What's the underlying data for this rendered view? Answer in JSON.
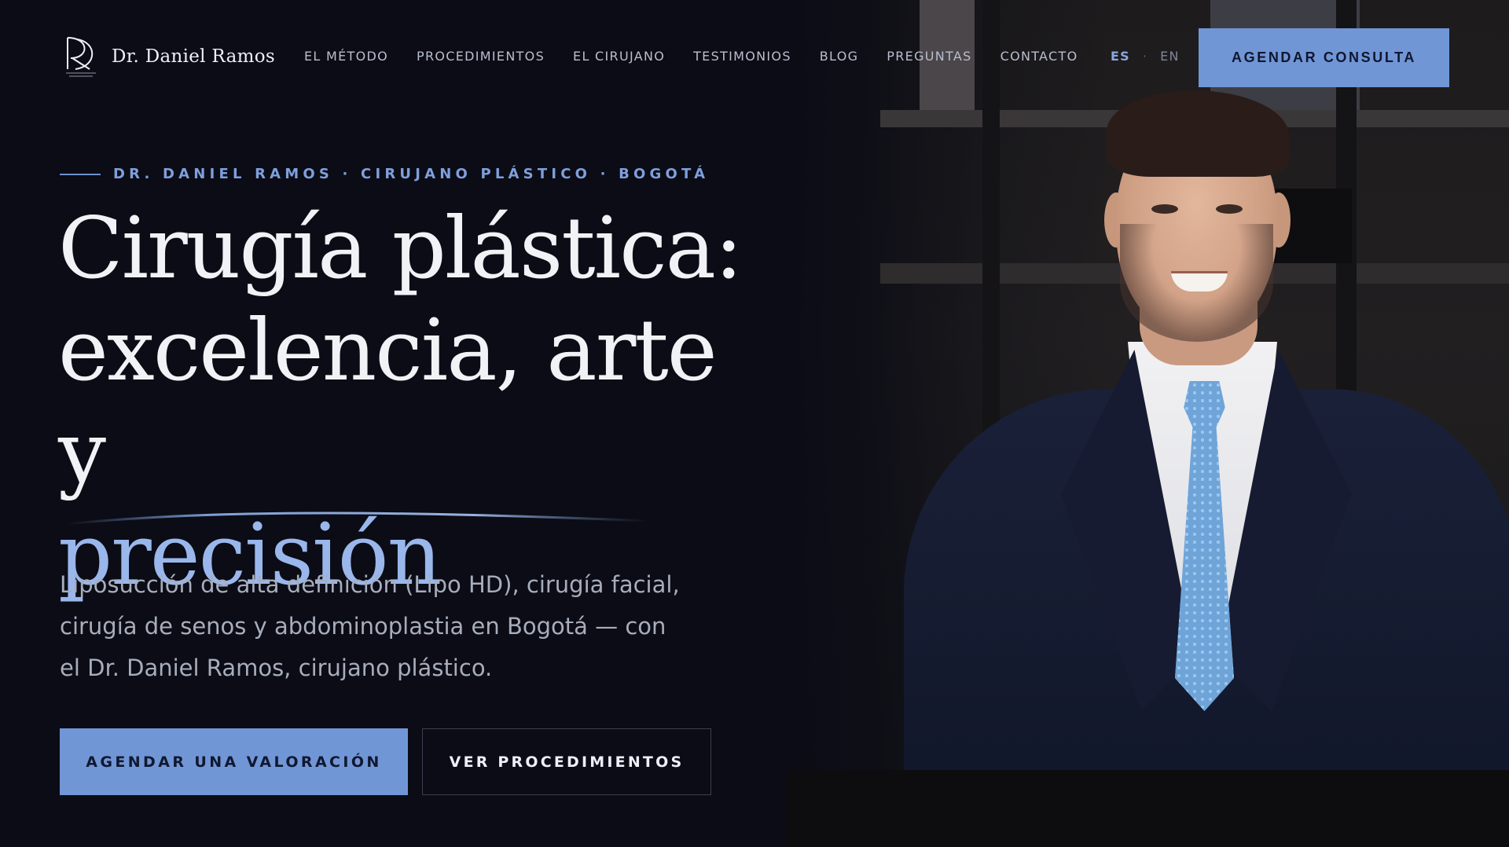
{
  "brand": {
    "name": "Dr. Daniel Ramos",
    "monogram": "DR",
    "accent_color": "#7196d6",
    "background_color": "#0b0c15"
  },
  "nav": {
    "links": [
      "EL MÉTODO",
      "PROCEDIMIENTOS",
      "EL CIRUJANO",
      "TESTIMONIOS",
      "BLOG",
      "PREGUNTAS",
      "CONTACTO"
    ],
    "lang": {
      "active": "ES",
      "separator": "·",
      "other": "EN"
    },
    "cta": "AGENDAR CONSULTA"
  },
  "hero": {
    "eyebrow": "DR. DANIEL RAMOS · CIRUJANO PLÁSTICO · BOGOTÁ",
    "headline_line1": "Cirugía plástica:",
    "headline_line2": "excelencia, arte y",
    "headline_accent": "precisión",
    "lead": "Liposucción de alta definición (Lipo HD), cirugía facial, cirugía de senos y abdominoplastia en Bogotá — con el Dr. Daniel Ramos, cirujano plástico.",
    "primary_button": "AGENDAR UNA VALORACIÓN",
    "secondary_button": "VER PROCEDIMIENTOS"
  }
}
